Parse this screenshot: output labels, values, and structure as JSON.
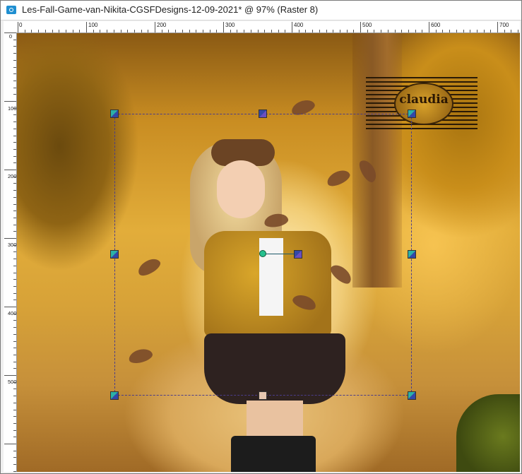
{
  "window": {
    "title": "Les-Fall-Game-van-Nikita-CGSFDesigns-12-09-2021* @  97% (Raster 8)"
  },
  "ruler": {
    "top_labels": [
      "0",
      "100",
      "200",
      "300",
      "400",
      "500",
      "600",
      "700"
    ],
    "left_labels": [
      "0",
      "100",
      "200",
      "300",
      "400",
      "500"
    ]
  },
  "canvas": {
    "watermark_text": "claudia"
  },
  "colors": {
    "selection_border": "#4a3c8a",
    "handle_teal": "#2db1a7",
    "handle_blue": "#3348a8"
  },
  "icons": {
    "app_icon": "camera-image-icon"
  }
}
